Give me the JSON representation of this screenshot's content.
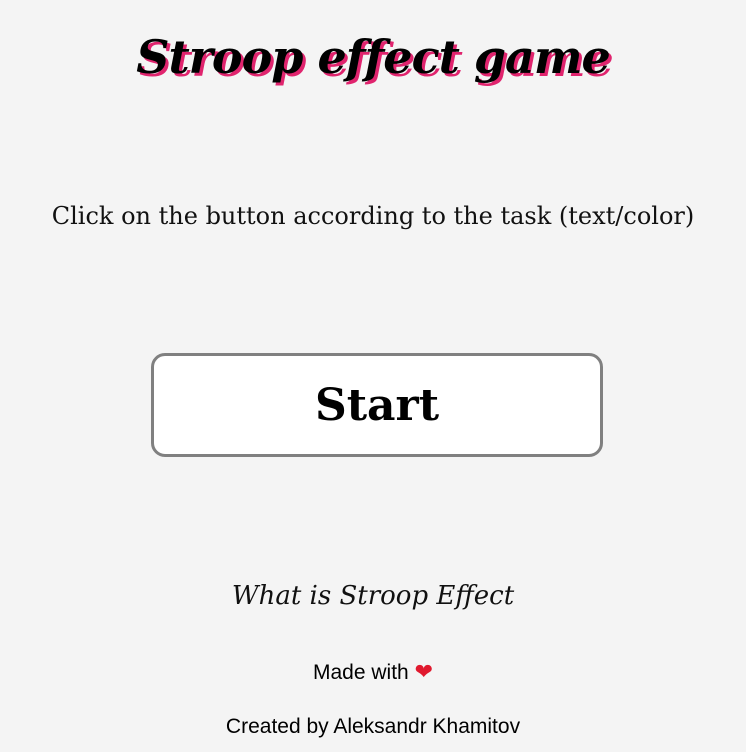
{
  "app": {
    "title": "Stroop effect game"
  },
  "instructions": "Click on the button according to the task (text/color)",
  "start_button": {
    "label": "Start"
  },
  "info_link": {
    "label": "What is Stroop Effect"
  },
  "footer": {
    "made_with": "Made with",
    "heart_icon": "heart-icon",
    "heart_glyph": "❤",
    "credits": "Created by Aleksandr Khamitov"
  },
  "colors": {
    "background": "#f4f4f4",
    "title_shadow": "#e0246e",
    "heart": "#e0192e",
    "button_border": "#808080"
  }
}
